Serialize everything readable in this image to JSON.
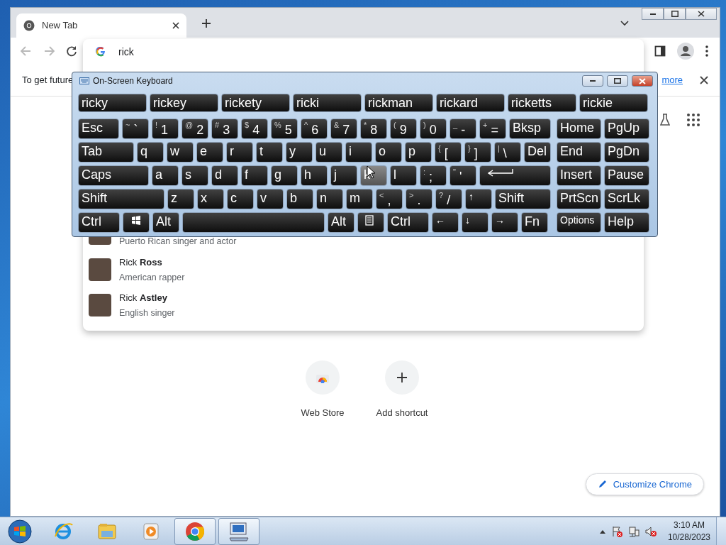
{
  "browser": {
    "tabs": [
      {
        "title": "New Tab",
        "selected": true
      }
    ],
    "toolbar_buttons": [
      {
        "kind": "back",
        "disabled": true
      },
      {
        "kind": "forward",
        "disabled": true
      },
      {
        "kind": "reload",
        "disabled": false
      }
    ],
    "omnibox": {
      "value": "rick"
    },
    "infobar": {
      "text": "To get future",
      "link": "more"
    },
    "suggestions": [
      {
        "subtitle": "Puerto Rican singer and actor"
      },
      {
        "title": "Rick **Ross**",
        "subtitle": "American rapper"
      },
      {
        "title": "Rick **Astley**",
        "subtitle": "English singer"
      }
    ],
    "shortcuts": [
      {
        "kind": "store",
        "label": "Web Store"
      },
      {
        "kind": "add",
        "label": "Add shortcut"
      }
    ],
    "customize_button": "Customize Chrome"
  },
  "keyboard": {
    "title": "On-Screen Keyboard",
    "predictions": [
      "ricky",
      "rickey",
      "rickety",
      "ricki",
      "rickman",
      "rickard",
      "ricketts",
      "rickie"
    ],
    "key_rows": [
      {
        "keys": [
          {
            "label": "Esc"
          },
          {
            "shift": "~",
            "label": "`"
          },
          {
            "shift": "!",
            "label": "1"
          },
          {
            "shift": "@",
            "label": "2"
          },
          {
            "shift": "#",
            "label": "3"
          },
          {
            "shift": "$",
            "label": "4"
          },
          {
            "shift": "%",
            "label": "5"
          },
          {
            "shift": "^",
            "label": "6"
          },
          {
            "shift": "&",
            "label": "7"
          },
          {
            "shift": "*",
            "label": "8"
          },
          {
            "shift": "(",
            "label": "9"
          },
          {
            "shift": ")",
            "label": "0"
          },
          {
            "shift": "_",
            "label": "-"
          },
          {
            "shift": "+",
            "label": "="
          },
          {
            "label": "Bksp"
          }
        ]
      },
      {
        "keys": [
          {
            "label": "Tab"
          },
          {
            "label": "q"
          },
          {
            "label": "w"
          },
          {
            "label": "e"
          },
          {
            "label": "r"
          },
          {
            "label": "t"
          },
          {
            "label": "y"
          },
          {
            "label": "u"
          },
          {
            "label": "i"
          },
          {
            "label": "o"
          },
          {
            "label": "p"
          },
          {
            "shift": "{",
            "label": "["
          },
          {
            "shift": "}",
            "label": "]"
          },
          {
            "shift": "|",
            "label": "\\"
          },
          {
            "label": "Del"
          }
        ]
      },
      {
        "keys": [
          {
            "label": "Caps"
          },
          {
            "label": "a"
          },
          {
            "label": "s"
          },
          {
            "label": "d"
          },
          {
            "label": "f"
          },
          {
            "label": "g"
          },
          {
            "label": "h"
          },
          {
            "label": "j"
          },
          {
            "label": "k",
            "hovered": true
          },
          {
            "label": "l"
          },
          {
            "shift": ":",
            "label": ";"
          },
          {
            "shift": "\"",
            "label": "'"
          },
          {
            "kind": "enter"
          }
        ]
      },
      {
        "keys": [
          {
            "label": "Shift"
          },
          {
            "label": "z"
          },
          {
            "label": "x"
          },
          {
            "label": "c"
          },
          {
            "label": "v"
          },
          {
            "label": "b"
          },
          {
            "label": "n"
          },
          {
            "label": "m"
          },
          {
            "shift": "<",
            "label": ","
          },
          {
            "shift": ">",
            "label": "."
          },
          {
            "shift": "?",
            "label": "/"
          },
          {
            "label": "↑"
          },
          {
            "label": "Shift"
          }
        ]
      },
      {
        "keys": [
          {
            "label": "Ctrl"
          },
          {
            "kind": "windows"
          },
          {
            "label": "Alt"
          },
          {
            "kind": "space"
          },
          {
            "label": "Alt"
          },
          {
            "kind": "menu"
          },
          {
            "label": "Ctrl"
          },
          {
            "label": "←"
          },
          {
            "label": "↓"
          },
          {
            "label": "→"
          },
          {
            "label": "Fn"
          }
        ]
      }
    ],
    "nav_rows": [
      [
        "Home",
        "PgUp"
      ],
      [
        "End",
        "PgDn"
      ],
      [
        "Insert",
        "Pause"
      ],
      [
        "PrtScn",
        "ScrLk"
      ],
      [
        "Options",
        "Help"
      ]
    ]
  },
  "taskbar": {
    "apps": [
      {
        "kind": "ie",
        "active": false
      },
      {
        "kind": "explorer",
        "active": false
      },
      {
        "kind": "media",
        "active": false
      },
      {
        "kind": "chrome",
        "active": true
      },
      {
        "kind": "keyboard",
        "active": true
      }
    ],
    "time": "3:10 AM",
    "date": "10/28/2023"
  }
}
